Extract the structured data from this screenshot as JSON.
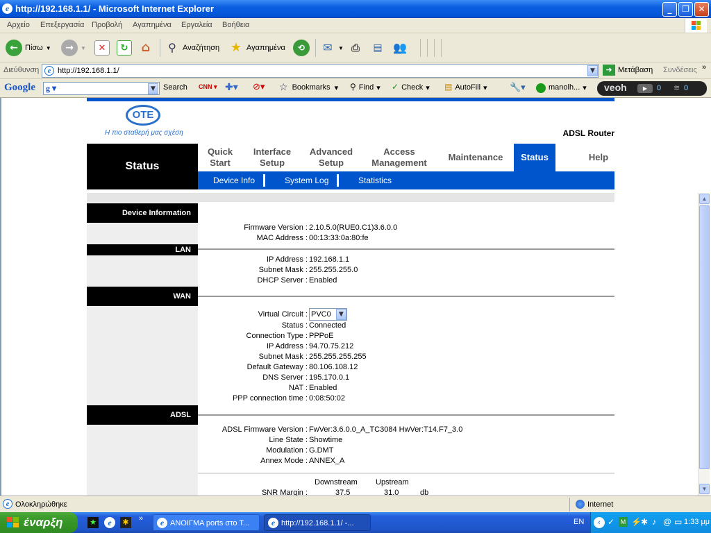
{
  "window": {
    "title": "http://192.168.1.1/ - Microsoft Internet Explorer"
  },
  "menu": [
    "Αρχείο",
    "Επεξεργασία",
    "Προβολή",
    "Αγαπημένα",
    "Εργαλεία",
    "Βοήθεια"
  ],
  "toolbar": {
    "back": "Πίσω",
    "search": "Αναζήτηση",
    "favorites": "Αγαπημένα"
  },
  "address": {
    "label": "Διεύθυνση",
    "url": "http://192.168.1.1/",
    "go": "Μετάβαση",
    "links": "Συνδέσεις"
  },
  "googlebar": {
    "logo": "Google",
    "search": "Search",
    "bookmarks": "Bookmarks",
    "find": "Find",
    "check": "Check",
    "autofill": "AutoFill",
    "user": "manolh...",
    "veoh": "veoh",
    "cnt1": "0",
    "cnt2": "0"
  },
  "router": {
    "slogan": "Η πιο σταθερή μας σχέση",
    "logo": "OTE",
    "product": "ADSL Router",
    "section": "Status",
    "nav": [
      {
        "l1": "Quick",
        "l2": "Start"
      },
      {
        "l1": "Interface",
        "l2": "Setup"
      },
      {
        "l1": "Advanced",
        "l2": "Setup"
      },
      {
        "l1": "Access",
        "l2": "Management"
      },
      {
        "l1": "Maintenance",
        "l2": ""
      },
      {
        "l1": "Status",
        "l2": ""
      },
      {
        "l1": "Help",
        "l2": ""
      }
    ],
    "subnav": [
      "Device Info",
      "System Log",
      "Statistics"
    ],
    "device": {
      "header": "Device Information",
      "rows": [
        {
          "label": "Firmware Version :",
          "value": "2.10.5.0(RUE0.C1)3.6.0.0"
        },
        {
          "label": "MAC Address :",
          "value": "00:13:33:0a:80:fe"
        }
      ]
    },
    "lan": {
      "header": "LAN",
      "rows": [
        {
          "label": "IP Address :",
          "value": "192.168.1.1"
        },
        {
          "label": "Subnet Mask :",
          "value": "255.255.255.0"
        },
        {
          "label": "DHCP Server :",
          "value": "Enabled"
        }
      ]
    },
    "wan": {
      "header": "WAN",
      "vc_label": "Virtual Circuit :",
      "vc_value": "PVC0",
      "rows": [
        {
          "label": "Status :",
          "value": "Connected"
        },
        {
          "label": "Connection Type :",
          "value": "PPPoE"
        },
        {
          "label": "IP Address :",
          "value": "94.70.75.212"
        },
        {
          "label": "Subnet Mask :",
          "value": "255.255.255.255"
        },
        {
          "label": "Default Gateway :",
          "value": "80.106.108.12"
        },
        {
          "label": "DNS Server :",
          "value": "195.170.0.1"
        },
        {
          "label": "NAT :",
          "value": "Enabled"
        },
        {
          "label": "PPP connection time :",
          "value": "0:08:50:02"
        }
      ]
    },
    "adsl": {
      "header": "ADSL",
      "rows": [
        {
          "label": "ADSL Firmware Version :",
          "value": "FwVer:3.6.0.0_A_TC3084 HwVer:T14.F7_3.0"
        },
        {
          "label": "Line State :",
          "value": "Showtime"
        },
        {
          "label": "Modulation :",
          "value": "G.DMT"
        },
        {
          "label": "Annex Mode :",
          "value": "ANNEX_A"
        }
      ],
      "downstream": "Downstream",
      "upstream": "Upstream",
      "snr_label": "SNR Margin :",
      "snr_down": "37.5",
      "snr_up": "31.0",
      "snr_unit": "db"
    }
  },
  "status": {
    "text": "Ολοκληρώθηκε",
    "zone": "Internet"
  },
  "taskbar": {
    "start": "έναρξη",
    "task1": "ΑΝΟΙΓΜΑ ports στο Τ...",
    "task2": "http://192.168.1.1/ -...",
    "lang": "EN",
    "clock": "1:33 μμ"
  }
}
